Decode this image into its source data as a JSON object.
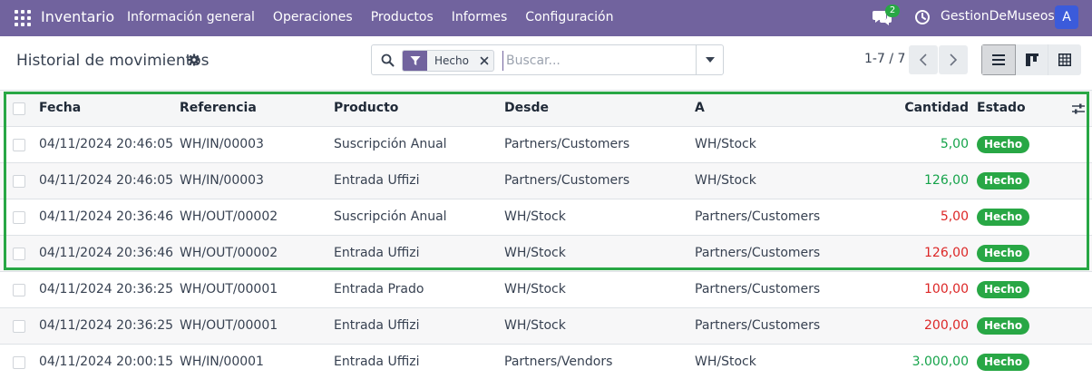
{
  "navbar": {
    "app_name": "Inventario",
    "menu": [
      "Información general",
      "Operaciones",
      "Productos",
      "Informes",
      "Configuración"
    ],
    "chat_badge_count": "2",
    "company": "GestionDeMuseos",
    "avatar_letter": "A",
    "colors": {
      "navbar_bg": "#71639e",
      "avatar_bg": "#3b5bdb",
      "badge_bg": "#28a745"
    }
  },
  "control_panel": {
    "title": "Historial de movimientos",
    "search": {
      "facet_value": "Hecho",
      "placeholder": "Buscar..."
    },
    "pager": "1-7 / 7",
    "views": [
      "list",
      "kanban",
      "pivot"
    ],
    "active_view": "list"
  },
  "table": {
    "headers": {
      "fecha": "Fecha",
      "referencia": "Referencia",
      "producto": "Producto",
      "desde": "Desde",
      "a": "A",
      "cantidad": "Cantidad",
      "estado": "Estado"
    },
    "rows": [
      {
        "fecha": "04/11/2024 20:46:05",
        "referencia": "WH/IN/00003",
        "producto": "Suscripción Anual",
        "desde": "Partners/Customers",
        "a": "WH/Stock",
        "cantidad": "5,00",
        "qty_color": "green",
        "estado": "Hecho"
      },
      {
        "fecha": "04/11/2024 20:46:05",
        "referencia": "WH/IN/00003",
        "producto": "Entrada Uffizi",
        "desde": "Partners/Customers",
        "a": "WH/Stock",
        "cantidad": "126,00",
        "qty_color": "green",
        "estado": "Hecho"
      },
      {
        "fecha": "04/11/2024 20:36:46",
        "referencia": "WH/OUT/00002",
        "producto": "Suscripción Anual",
        "desde": "WH/Stock",
        "a": "Partners/Customers",
        "cantidad": "5,00",
        "qty_color": "red",
        "estado": "Hecho"
      },
      {
        "fecha": "04/11/2024 20:36:46",
        "referencia": "WH/OUT/00002",
        "producto": "Entrada Uffizi",
        "desde": "WH/Stock",
        "a": "Partners/Customers",
        "cantidad": "126,00",
        "qty_color": "red",
        "estado": "Hecho"
      },
      {
        "fecha": "04/11/2024 20:36:25",
        "referencia": "WH/OUT/00001",
        "producto": "Entrada Prado",
        "desde": "WH/Stock",
        "a": "Partners/Customers",
        "cantidad": "100,00",
        "qty_color": "red",
        "estado": "Hecho"
      },
      {
        "fecha": "04/11/2024 20:36:25",
        "referencia": "WH/OUT/00001",
        "producto": "Entrada Uffizi",
        "desde": "WH/Stock",
        "a": "Partners/Customers",
        "cantidad": "200,00",
        "qty_color": "red",
        "estado": "Hecho"
      },
      {
        "fecha": "04/11/2024 20:00:15",
        "referencia": "WH/IN/00001",
        "producto": "Entrada Uffizi",
        "desde": "Partners/Vendors",
        "a": "WH/Stock",
        "cantidad": "3.000,00",
        "qty_color": "green",
        "estado": "Hecho"
      }
    ],
    "status_color": "#28a745",
    "highlight_color": "#28a745"
  }
}
